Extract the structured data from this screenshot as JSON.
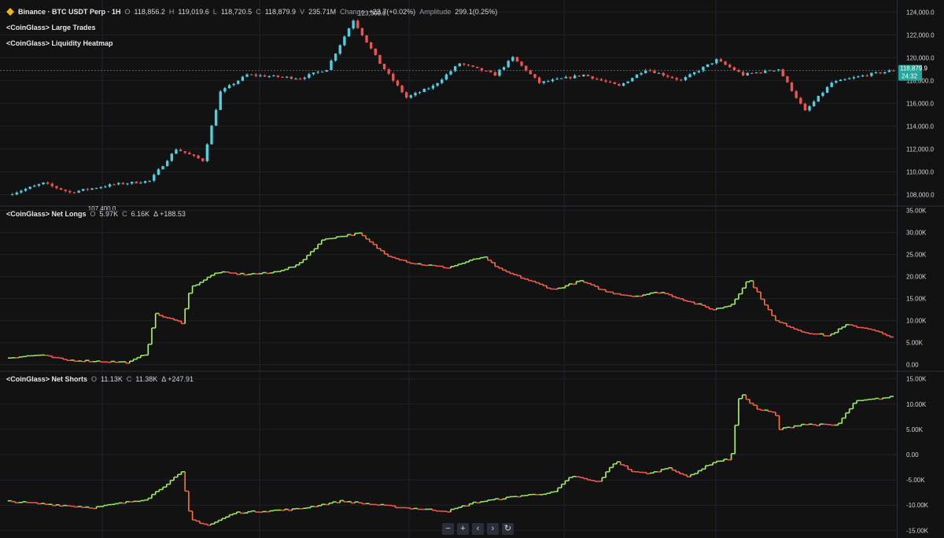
{
  "main_legend": {
    "symbol": "Binance · BTC USDT Perp · 1H",
    "o_label": "O",
    "o": "118,856.2",
    "h_label": "H",
    "h": "119,019.6",
    "l_label": "L",
    "l": "118,720.5",
    "c_label": "C",
    "c": "118,879.9",
    "v_label": "V",
    "v": "235.71M",
    "change_label": "Change",
    "change": "+23.7(+0.02%)",
    "amp_label": "Amplitude",
    "amp": "299.1(0.25%)"
  },
  "indicators": {
    "large_trades": "<CoinGlass> Large Trades",
    "liq_heatmap": "<CoinGlass> Liquidity Heatmap"
  },
  "net_longs_legend": {
    "name": "<CoinGlass> Net Longs",
    "o_label": "O",
    "o": "5.97K",
    "c_label": "C",
    "c": "6.16K",
    "d": "Δ +188.53"
  },
  "net_shorts_legend": {
    "name": "<CoinGlass> Net Shorts",
    "o_label": "O",
    "o": "11.13K",
    "c_label": "C",
    "c": "11.38K",
    "d": "Δ +247.91"
  },
  "toolbar": {
    "zoom_out": "−",
    "zoom_in": "+",
    "left": "‹",
    "right": "›",
    "reset": "↻"
  },
  "colors": {
    "up": "#4dd0e1",
    "down": "#ef5350",
    "bg": "#121212",
    "grid": "#1e2128",
    "axis_text": "#d1d4dc",
    "price_tag": "#26a69a"
  },
  "chart_data": [
    {
      "type": "candlestick",
      "title": "Binance · BTC USDT Perp · 1H",
      "ylim": [
        107000,
        124500
      ],
      "yticks": [
        "124,000.0",
        "122,000.0",
        "120,000.0",
        "118,000.0",
        "116,000.0",
        "114,000.0",
        "112,000.0",
        "110,000.0",
        "108,000.0"
      ],
      "ytick_values": [
        124000,
        122000,
        120000,
        118000,
        116000,
        114000,
        112000,
        110000,
        108000
      ],
      "last_price": "118,879.9",
      "countdown": "24:32",
      "annotations": [
        {
          "label": "123,300.0",
          "value": 123300,
          "kind": "high"
        },
        {
          "label": "107,400.0",
          "value": 107400,
          "kind": "low"
        }
      ],
      "anchors": [
        [
          0,
          108000
        ],
        [
          0.04,
          109000
        ],
        [
          0.07,
          108200
        ],
        [
          0.12,
          108900
        ],
        [
          0.16,
          109200
        ],
        [
          0.19,
          112000
        ],
        [
          0.22,
          111000
        ],
        [
          0.24,
          117000
        ],
        [
          0.27,
          118500
        ],
        [
          0.33,
          118200
        ],
        [
          0.36,
          119000
        ],
        [
          0.39,
          123300
        ],
        [
          0.42,
          119500
        ],
        [
          0.45,
          116500
        ],
        [
          0.48,
          117500
        ],
        [
          0.51,
          119500
        ],
        [
          0.55,
          118500
        ],
        [
          0.57,
          120000
        ],
        [
          0.6,
          117800
        ],
        [
          0.65,
          118500
        ],
        [
          0.69,
          117500
        ],
        [
          0.72,
          119000
        ],
        [
          0.76,
          118000
        ],
        [
          0.8,
          119800
        ],
        [
          0.83,
          118500
        ],
        [
          0.87,
          119000
        ],
        [
          0.9,
          115300
        ],
        [
          0.93,
          117800
        ],
        [
          0.97,
          118500
        ],
        [
          1,
          118880
        ]
      ],
      "count": 200
    },
    {
      "type": "step",
      "title": "<CoinGlass> Net Longs",
      "ylim": [
        -1500,
        36000
      ],
      "yticks": [
        "35.00K",
        "30.00K",
        "25.00K",
        "20.00K",
        "15.00K",
        "10.00K",
        "5.00K",
        "0.00"
      ],
      "ytick_values": [
        35000,
        30000,
        25000,
        20000,
        15000,
        10000,
        5000,
        0
      ],
      "anchors": [
        [
          0,
          1500
        ],
        [
          0.04,
          2200
        ],
        [
          0.07,
          1000
        ],
        [
          0.14,
          500
        ],
        [
          0.16,
          2500
        ],
        [
          0.17,
          11500
        ],
        [
          0.2,
          9500
        ],
        [
          0.21,
          17500
        ],
        [
          0.24,
          21000
        ],
        [
          0.27,
          20500
        ],
        [
          0.3,
          20800
        ],
        [
          0.33,
          22500
        ],
        [
          0.36,
          28500
        ],
        [
          0.4,
          29800
        ],
        [
          0.43,
          25000
        ],
        [
          0.46,
          23000
        ],
        [
          0.5,
          22000
        ],
        [
          0.54,
          24500
        ],
        [
          0.56,
          21500
        ],
        [
          0.6,
          18500
        ],
        [
          0.62,
          17000
        ],
        [
          0.65,
          19000
        ],
        [
          0.68,
          16500
        ],
        [
          0.71,
          15500
        ],
        [
          0.74,
          16500
        ],
        [
          0.77,
          14500
        ],
        [
          0.8,
          12500
        ],
        [
          0.82,
          13500
        ],
        [
          0.84,
          19500
        ],
        [
          0.87,
          10000
        ],
        [
          0.9,
          7500
        ],
        [
          0.93,
          6500
        ],
        [
          0.95,
          9000
        ],
        [
          0.98,
          8000
        ],
        [
          1,
          6160
        ]
      ],
      "count": 240
    },
    {
      "type": "step",
      "title": "<CoinGlass> Net Shorts",
      "ylim": [
        -16500,
        16500
      ],
      "yticks": [
        "15.00K",
        "10.00K",
        "5.00K",
        "0.00",
        "-5.00K",
        "-10.00K",
        "-15.00K"
      ],
      "ytick_values": [
        15000,
        10000,
        5000,
        0,
        -5000,
        -10000,
        -15000
      ],
      "anchors": [
        [
          0,
          -9200
        ],
        [
          0.1,
          -10500
        ],
        [
          0.16,
          -8800
        ],
        [
          0.2,
          -3500
        ],
        [
          0.21,
          -12800
        ],
        [
          0.23,
          -14000
        ],
        [
          0.26,
          -11500
        ],
        [
          0.33,
          -10800
        ],
        [
          0.38,
          -9200
        ],
        [
          0.45,
          -10500
        ],
        [
          0.5,
          -11200
        ],
        [
          0.53,
          -9500
        ],
        [
          0.58,
          -8200
        ],
        [
          0.62,
          -7500
        ],
        [
          0.64,
          -4200
        ],
        [
          0.67,
          -5500
        ],
        [
          0.69,
          -1200
        ],
        [
          0.71,
          -3500
        ],
        [
          0.73,
          -3700
        ],
        [
          0.75,
          -2500
        ],
        [
          0.77,
          -4500
        ],
        [
          0.8,
          -1500
        ],
        [
          0.82,
          -800
        ],
        [
          0.83,
          12200
        ],
        [
          0.85,
          9000
        ],
        [
          0.87,
          8200
        ],
        [
          0.875,
          5000
        ],
        [
          0.9,
          6000
        ],
        [
          0.94,
          5800
        ],
        [
          0.96,
          10500
        ],
        [
          1,
          11380
        ]
      ],
      "count": 240
    }
  ]
}
